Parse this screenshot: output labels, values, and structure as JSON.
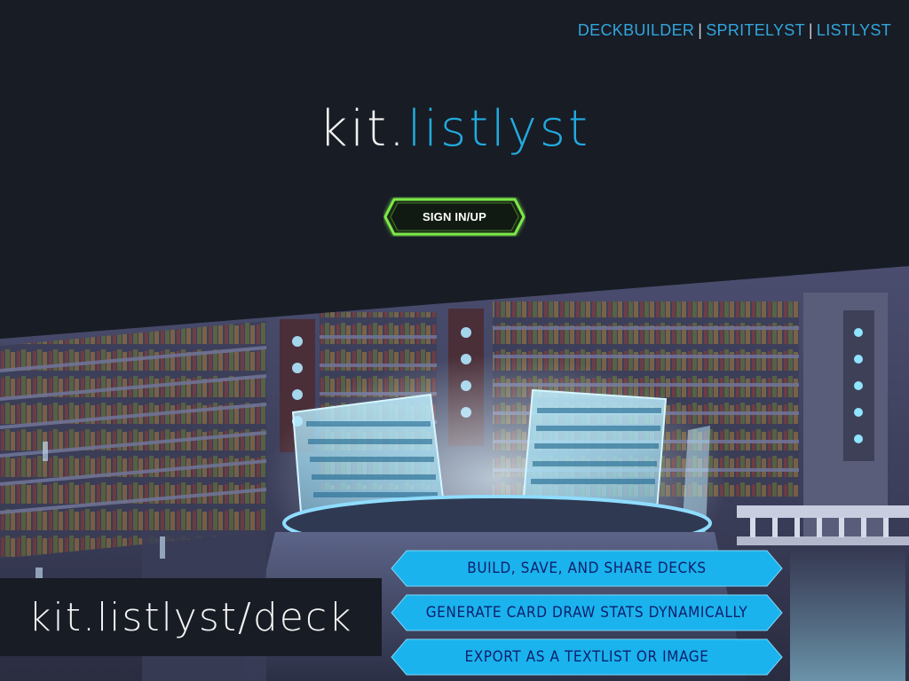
{
  "nav": {
    "deckbuilder": "DECKBUILDER",
    "spritelyst": "SPRITELYST",
    "listlyst": "LISTLYST",
    "separator": "|"
  },
  "logo": {
    "prefix": "kit.",
    "name": "listlyst"
  },
  "signin": {
    "label": "SIGN IN/UP"
  },
  "deck_label": "kit.listlyst/deck",
  "features": [
    "BUILD, SAVE, AND SHARE DECKS",
    "GENERATE CARD DRAW STATS DYNAMICALLY",
    "EXPORT AS A TEXTLIST OR IMAGE"
  ],
  "colors": {
    "background": "#181c25",
    "accent_blue": "#22aadf",
    "button_green": "#7de84a",
    "ribbon_blue": "#1ab3ee",
    "ribbon_text": "#0d1f6a"
  },
  "icons": [
    "holographic-rune-panel",
    "library-shelves"
  ]
}
